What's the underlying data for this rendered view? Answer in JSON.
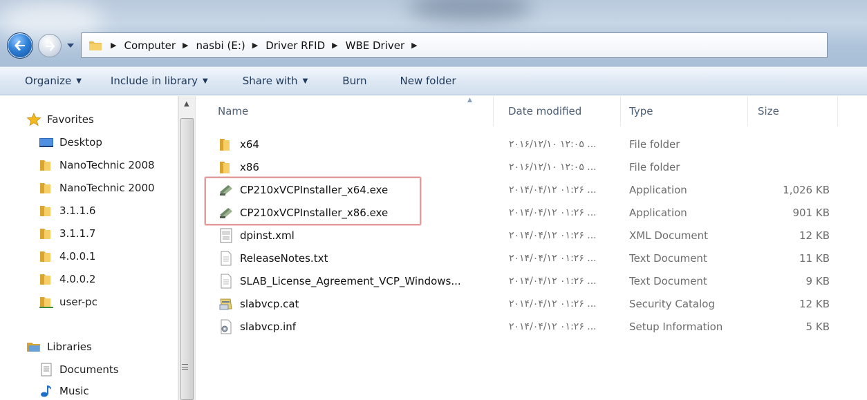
{
  "address": {
    "crumbs": [
      "Computer",
      "nasbi (E:)",
      "Driver RFID",
      "WBE Driver"
    ]
  },
  "toolbar": {
    "organize": "Organize",
    "include_library": "Include in library",
    "share_with": "Share with",
    "burn": "Burn",
    "new_folder": "New folder"
  },
  "nav": {
    "favorites": "Favorites",
    "items": [
      {
        "label": "Desktop",
        "icon": "desktop-icon"
      },
      {
        "label": "NanoTechnic 2008",
        "icon": "folder-icon"
      },
      {
        "label": "NanoTechnic 2000",
        "icon": "folder-icon"
      },
      {
        "label": "3.1.1.6",
        "icon": "folder-icon"
      },
      {
        "label": "3.1.1.7",
        "icon": "folder-icon"
      },
      {
        "label": "4.0.0.1",
        "icon": "folder-icon"
      },
      {
        "label": "4.0.0.2",
        "icon": "folder-icon"
      },
      {
        "label": "user-pc",
        "icon": "user-folder-icon"
      }
    ],
    "libraries": "Libraries",
    "library_items": [
      {
        "label": "Documents",
        "icon": "documents-icon"
      },
      {
        "label": "Music",
        "icon": "music-icon"
      }
    ]
  },
  "columns": {
    "name": "Name",
    "date": "Date modified",
    "type": "Type",
    "size": "Size"
  },
  "files": [
    {
      "name": "x64",
      "date": "۲۰۱۶/۱۲/۱۰ ۱۲:۰۵ ...",
      "type": "File folder",
      "size": "",
      "icon": "folder-icon"
    },
    {
      "name": "x86",
      "date": "۲۰۱۶/۱۲/۱۰ ۱۲:۰۵ ...",
      "type": "File folder",
      "size": "",
      "icon": "folder-icon"
    },
    {
      "name": "CP210xVCPInstaller_x64.exe",
      "date": "۲۰۱۴/۰۴/۱۲ ۰۱:۲۶ ...",
      "type": "Application",
      "size": "1,026 KB",
      "icon": "installer-icon"
    },
    {
      "name": "CP210xVCPInstaller_x86.exe",
      "date": "۲۰۱۴/۰۴/۱۲ ۰۱:۲۶ ...",
      "type": "Application",
      "size": "901 KB",
      "icon": "installer-icon"
    },
    {
      "name": "dpinst.xml",
      "date": "۲۰۱۴/۰۴/۱۲ ۰۱:۲۶ ...",
      "type": "XML Document",
      "size": "12 KB",
      "icon": "xml-icon"
    },
    {
      "name": "ReleaseNotes.txt",
      "date": "۲۰۱۴/۰۴/۱۲ ۰۱:۲۶ ...",
      "type": "Text Document",
      "size": "11 KB",
      "icon": "text-file-icon"
    },
    {
      "name": "SLAB_License_Agreement_VCP_Windows...",
      "date": "۲۰۱۴/۰۴/۱۲ ۰۱:۲۶ ...",
      "type": "Text Document",
      "size": "9 KB",
      "icon": "text-file-icon"
    },
    {
      "name": "slabvcp.cat",
      "date": "۲۰۱۴/۰۴/۱۲ ۰۱:۲۶ ...",
      "type": "Security Catalog",
      "size": "12 KB",
      "icon": "catalog-icon"
    },
    {
      "name": "slabvcp.inf",
      "date": "۲۰۱۴/۰۴/۱۲ ۰۱:۲۶ ...",
      "type": "Setup Information",
      "size": "5 KB",
      "icon": "setup-info-icon"
    }
  ]
}
